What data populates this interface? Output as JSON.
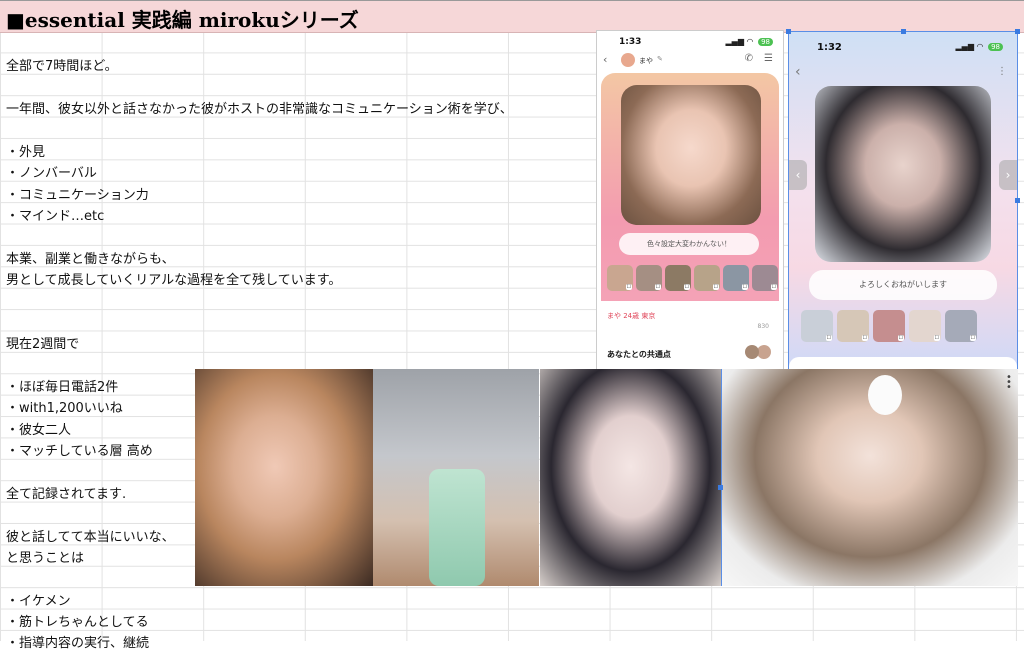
{
  "title": "■essential 実践編 mirokuシリーズ",
  "lines": [
    "全部で7時間ほど。",
    "一年間、彼女以外と話さなかった彼がホストの非常識なコミュニケーション術を学び、",
    "・外見",
    "・ノンバーバル",
    "・コミュニケーション力",
    "・マインド…etc",
    "本業、副業と働きながらも、",
    "男として成長していくリアルな過程を全て残しています。",
    "現在2週間で",
    "・ほぼ毎日電話2件",
    "・with1,200いいね",
    "・彼女二人",
    "・マッチしている層 高め",
    "全て記録されてます.",
    "彼と話してて本当にいいな、",
    "と思うことは",
    "・イケメン",
    "・筋トレちゃんとしてる",
    "・指導内容の実行、継続"
  ],
  "phone1": {
    "time": "1:33",
    "battery": "98",
    "name": "まや",
    "message": "色々設定大変わかんない！",
    "profile": "まや 24歳 東京",
    "likes": "830",
    "common": "あなたとの共通点"
  },
  "phone2": {
    "time": "1:32",
    "battery": "98",
    "message": "よろしくおねがいします"
  },
  "colors": {
    "title_bg": "#f6d7d8",
    "grid": "#e2e2e2",
    "selection": "#3b7be0"
  },
  "icons": [
    "back-arrow-icon",
    "phone-icon",
    "menu-dots-icon",
    "wifi-icon",
    "signal-icon",
    "pencil-icon",
    "chevron-left-icon",
    "chevron-right-icon"
  ]
}
